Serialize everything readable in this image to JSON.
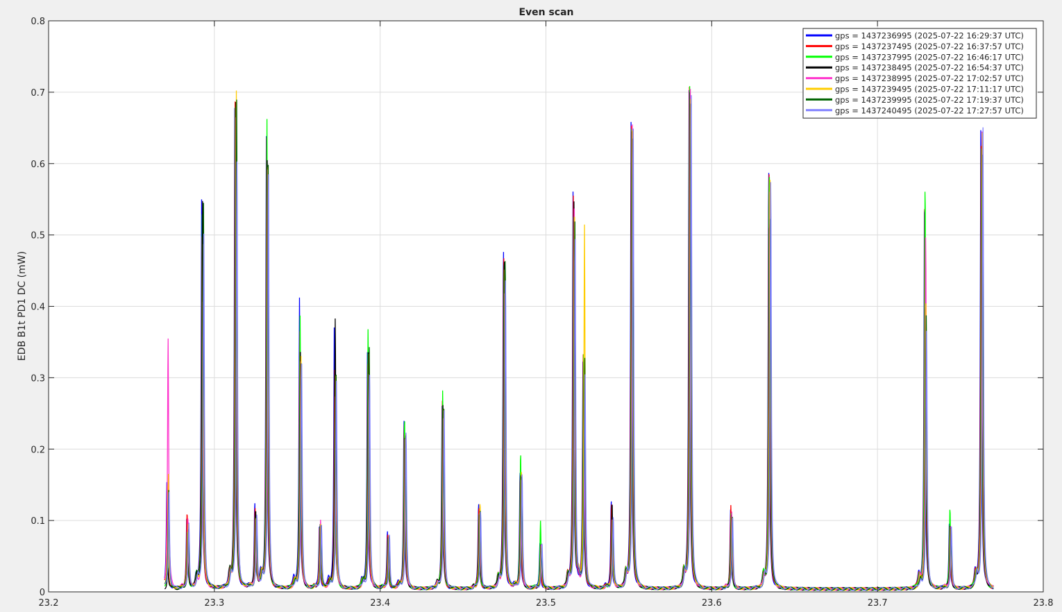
{
  "chart_data": {
    "type": "line",
    "title": "Even scan",
    "xlabel": "",
    "ylabel": "EDB B1t PD1 DC (mW)",
    "xlim": [
      23.2,
      23.8
    ],
    "ylim": [
      0,
      0.8
    ],
    "xticks": [
      23.2,
      23.3,
      23.4,
      23.5,
      23.6,
      23.7,
      23.8
    ],
    "yticks": [
      0,
      0.1,
      0.2,
      0.3,
      0.4,
      0.5,
      0.6,
      0.7,
      0.8
    ],
    "xtick_labels": [
      "23.2",
      "23.3",
      "23.4",
      "23.5",
      "23.6",
      "23.7",
      "23.8"
    ],
    "ytick_labels": [
      "0",
      "0.1",
      "0.2",
      "0.3",
      "0.4",
      "0.5",
      "0.6",
      "0.7",
      "0.8"
    ],
    "grid": true,
    "legend_position": "top-right",
    "x_range": [
      23.27,
      23.77
    ],
    "peaks": [
      {
        "x": 23.272,
        "heights": [
          0.148,
          0.145,
          0.06,
          0.03,
          0.35,
          0.16,
          0.14,
          0.14
        ]
      },
      {
        "x": 23.284,
        "heights": [
          0.1,
          0.105,
          0.08,
          0.08,
          0.1,
          0.09,
          0.08,
          0.09
        ]
      },
      {
        "x": 23.293,
        "heights": [
          0.555,
          0.5,
          0.53,
          0.545,
          0.4,
          0.48,
          0.54,
          0.5
        ]
      },
      {
        "x": 23.313,
        "heights": [
          0.685,
          0.69,
          0.68,
          0.685,
          0.66,
          0.695,
          0.683,
          0.6
        ]
      },
      {
        "x": 23.325,
        "heights": [
          0.118,
          0.11,
          0.1,
          0.11,
          0.1,
          0.1,
          0.095,
          0.1
        ]
      },
      {
        "x": 23.332,
        "heights": [
          0.635,
          0.63,
          0.655,
          0.6,
          0.59,
          0.595,
          0.6,
          0.59
        ]
      },
      {
        "x": 23.352,
        "heights": [
          0.41,
          0.36,
          0.38,
          0.33,
          0.32,
          0.33,
          0.32,
          0.32
        ]
      },
      {
        "x": 23.364,
        "heights": [
          0.09,
          0.09,
          0.09,
          0.09,
          0.095,
          0.09,
          0.09,
          0.09
        ]
      },
      {
        "x": 23.373,
        "heights": [
          0.375,
          0.31,
          0.3,
          0.378,
          0.27,
          0.3,
          0.3,
          0.29
        ]
      },
      {
        "x": 23.393,
        "heights": [
          0.34,
          0.32,
          0.365,
          0.33,
          0.3,
          0.33,
          0.34,
          0.3
        ]
      },
      {
        "x": 23.405,
        "heights": [
          0.08,
          0.078,
          0.075,
          0.075,
          0.075,
          0.075,
          0.075,
          0.078
        ]
      },
      {
        "x": 23.415,
        "heights": [
          0.24,
          0.235,
          0.24,
          0.22,
          0.22,
          0.225,
          0.22,
          0.22
        ]
      },
      {
        "x": 23.438,
        "heights": [
          0.26,
          0.265,
          0.28,
          0.26,
          0.24,
          0.25,
          0.25,
          0.25
        ]
      },
      {
        "x": 23.46,
        "heights": [
          0.118,
          0.115,
          0.11,
          0.11,
          0.11,
          0.12,
          0.11,
          0.11
        ]
      },
      {
        "x": 23.475,
        "heights": [
          0.478,
          0.475,
          0.47,
          0.478,
          0.43,
          0.46,
          0.47,
          0.44
        ]
      },
      {
        "x": 23.485,
        "heights": [
          0.165,
          0.16,
          0.19,
          0.165,
          0.16,
          0.17,
          0.16,
          0.16
        ]
      },
      {
        "x": 23.497,
        "heights": [
          0.065,
          0.06,
          0.095,
          0.06,
          0.06,
          0.06,
          0.06,
          0.065
        ]
      },
      {
        "x": 23.517,
        "heights": [
          0.555,
          0.55,
          0.52,
          0.54,
          0.53,
          0.52,
          0.52,
          0.5
        ]
      },
      {
        "x": 23.523,
        "heights": [
          0.32,
          0.33,
          0.33,
          0.32,
          0.3,
          0.505,
          0.32,
          0.3
        ]
      },
      {
        "x": 23.54,
        "heights": [
          0.125,
          0.12,
          0.1,
          0.12,
          0.1,
          0.1,
          0.1,
          0.1
        ]
      },
      {
        "x": 23.552,
        "heights": [
          0.655,
          0.65,
          0.645,
          0.64,
          0.65,
          0.645,
          0.64,
          0.66
        ]
      },
      {
        "x": 23.587,
        "heights": [
          0.7,
          0.705,
          0.705,
          0.695,
          0.7,
          0.69,
          0.69,
          0.708
        ]
      },
      {
        "x": 23.612,
        "heights": [
          0.11,
          0.115,
          0.105,
          0.105,
          0.11,
          0.1,
          0.1,
          0.1
        ]
      },
      {
        "x": 23.635,
        "heights": [
          0.59,
          0.595,
          0.598,
          0.535,
          0.58,
          0.59,
          0.53,
          0.58
        ]
      },
      {
        "x": 23.729,
        "heights": [
          0.558,
          0.555,
          0.572,
          0.4,
          0.5,
          0.405,
          0.385,
          0.36
        ]
      },
      {
        "x": 23.744,
        "heights": [
          0.095,
          0.09,
          0.112,
          0.09,
          0.09,
          0.085,
          0.085,
          0.085
        ]
      },
      {
        "x": 23.763,
        "heights": [
          0.658,
          0.63,
          0.62,
          0.62,
          0.64,
          0.64,
          0.61,
          0.648
        ]
      }
    ],
    "series": [
      {
        "name": "gps = 1437236995 (2025-07-22 16:29:37 UTC)",
        "color": "#0000ff"
      },
      {
        "name": "gps = 1437237495 (2025-07-22 16:37:57 UTC)",
        "color": "#ff0000"
      },
      {
        "name": "gps = 1437237995 (2025-07-22 16:46:17 UTC)",
        "color": "#00ff00"
      },
      {
        "name": "gps = 1437238495 (2025-07-22 16:54:37 UTC)",
        "color": "#000000"
      },
      {
        "name": "gps = 1437238995 (2025-07-22 17:02:57 UTC)",
        "color": "#ff33cc"
      },
      {
        "name": "gps = 1437239495 (2025-07-22 17:11:17 UTC)",
        "color": "#ffcc00"
      },
      {
        "name": "gps = 1437239995 (2025-07-22 17:19:37 UTC)",
        "color": "#006400"
      },
      {
        "name": "gps = 1437240495 (2025-07-22 17:27:57 UTC)",
        "color": "#8080ff"
      }
    ]
  }
}
